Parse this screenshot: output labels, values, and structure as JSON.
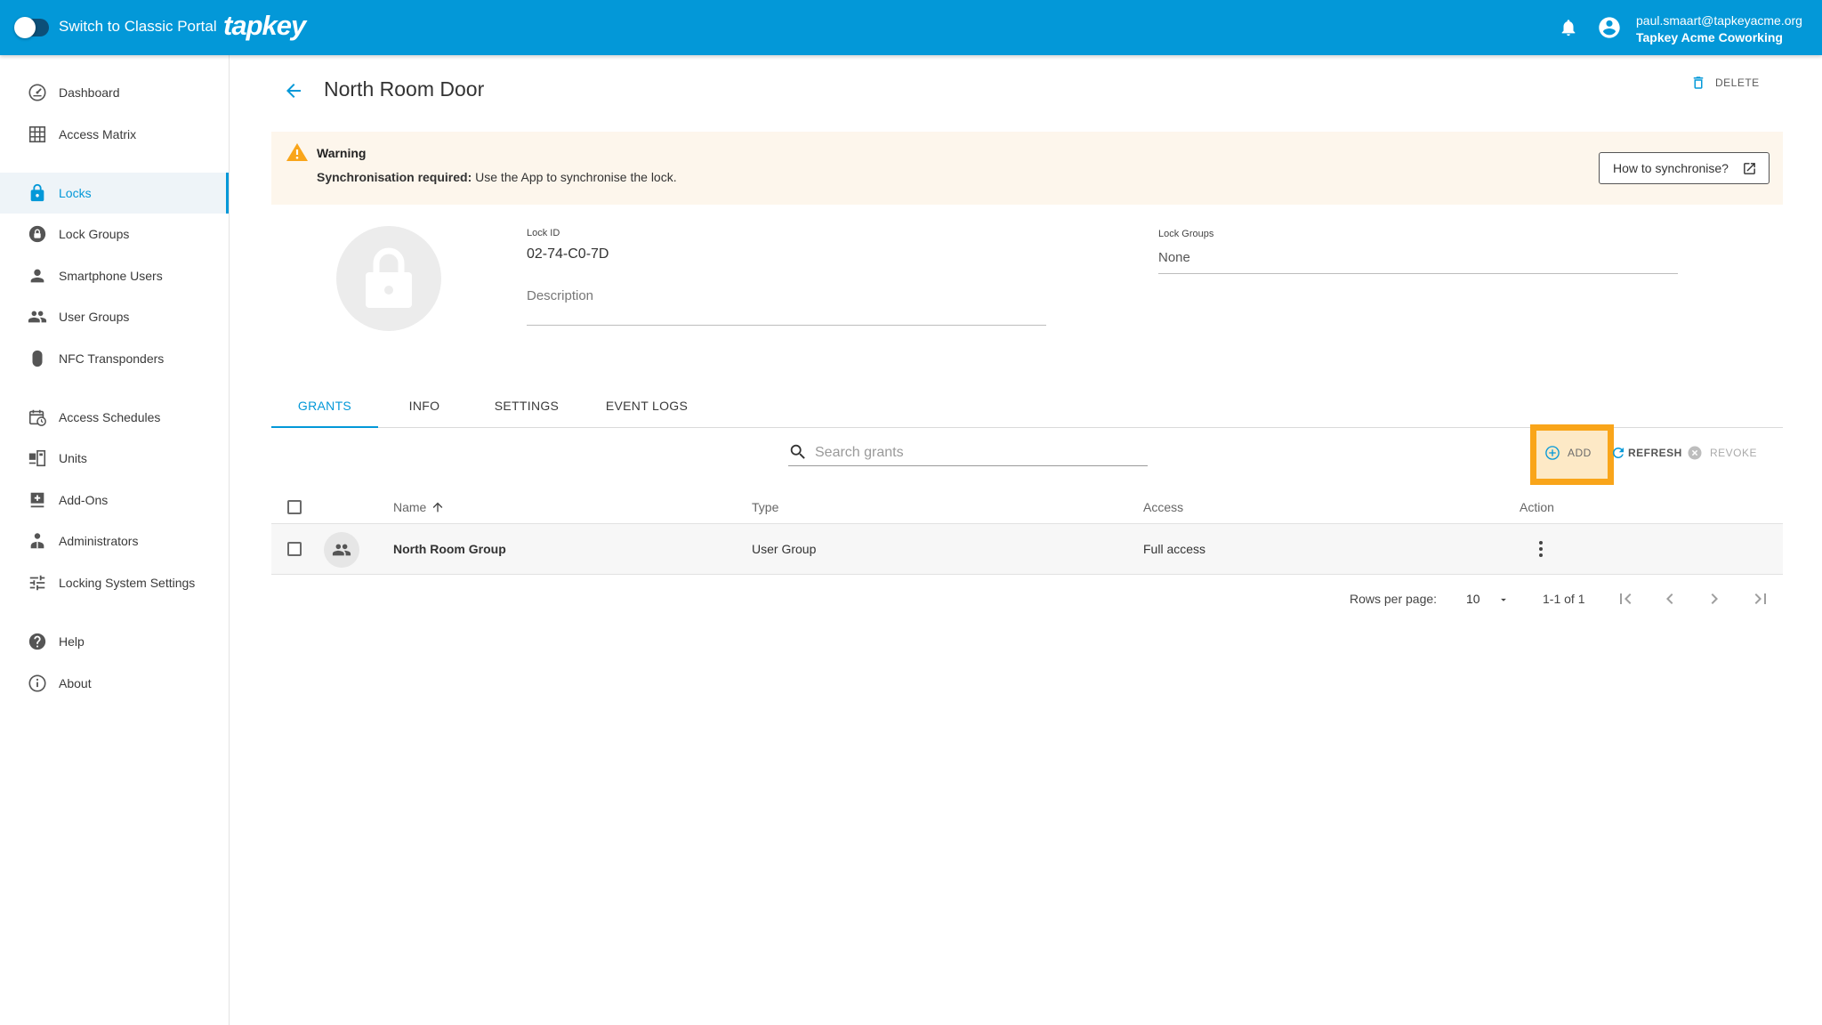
{
  "topbar": {
    "toggle_label": "Switch to Classic Portal",
    "brand": "tapkey",
    "user_email": "paul.smaart@tapkeyacme.org",
    "user_org": "Tapkey Acme Coworking"
  },
  "sidebar": {
    "items": [
      {
        "label": "Dashboard",
        "icon": "dashboard-icon"
      },
      {
        "label": "Access Matrix",
        "icon": "grid-icon"
      },
      {
        "label": "Locks",
        "icon": "lock-icon",
        "active": true
      },
      {
        "label": "Lock Groups",
        "icon": "lock-group-icon"
      },
      {
        "label": "Smartphone Users",
        "icon": "person-icon"
      },
      {
        "label": "User Groups",
        "icon": "people-icon"
      },
      {
        "label": "NFC Transponders",
        "icon": "transponder-icon"
      },
      {
        "label": "Access Schedules",
        "icon": "schedule-icon"
      },
      {
        "label": "Units",
        "icon": "units-icon"
      },
      {
        "label": "Add-Ons",
        "icon": "addon-icon"
      },
      {
        "label": "Administrators",
        "icon": "admin-icon"
      },
      {
        "label": "Locking System Settings",
        "icon": "settings-sliders-icon"
      },
      {
        "label": "Help",
        "icon": "help-icon"
      },
      {
        "label": "About",
        "icon": "info-icon"
      }
    ]
  },
  "header": {
    "title": "North Room Door",
    "delete_label": "DELETE"
  },
  "banner": {
    "title": "Warning",
    "text_bold": "Synchronisation required:",
    "text": " Use the App to synchronise the lock.",
    "button_label": "How to synchronise?"
  },
  "lock": {
    "id_label": "Lock ID",
    "id_value": "02-74-C0-7D",
    "description_placeholder": "Description",
    "groups_label": "Lock Groups",
    "groups_value": "None"
  },
  "tabs": [
    "GRANTS",
    "INFO",
    "SETTINGS",
    "EVENT LOGS"
  ],
  "toolbar": {
    "search_placeholder": "Search grants",
    "add_label": "ADD",
    "refresh_label": "REFRESH",
    "revoke_label": "REVOKE"
  },
  "table": {
    "columns": [
      "Name",
      "Type",
      "Access",
      "Action"
    ],
    "rows": [
      {
        "name": "North Room Group",
        "type": "User Group",
        "access": "Full access"
      }
    ]
  },
  "pagination": {
    "rows_label": "Rows per page:",
    "rows_value": "10",
    "range": "1-1 of 1"
  },
  "colors": {
    "primary": "#0398d8",
    "warning": "#f9a51a",
    "banner_bg": "#fdf6ec"
  }
}
